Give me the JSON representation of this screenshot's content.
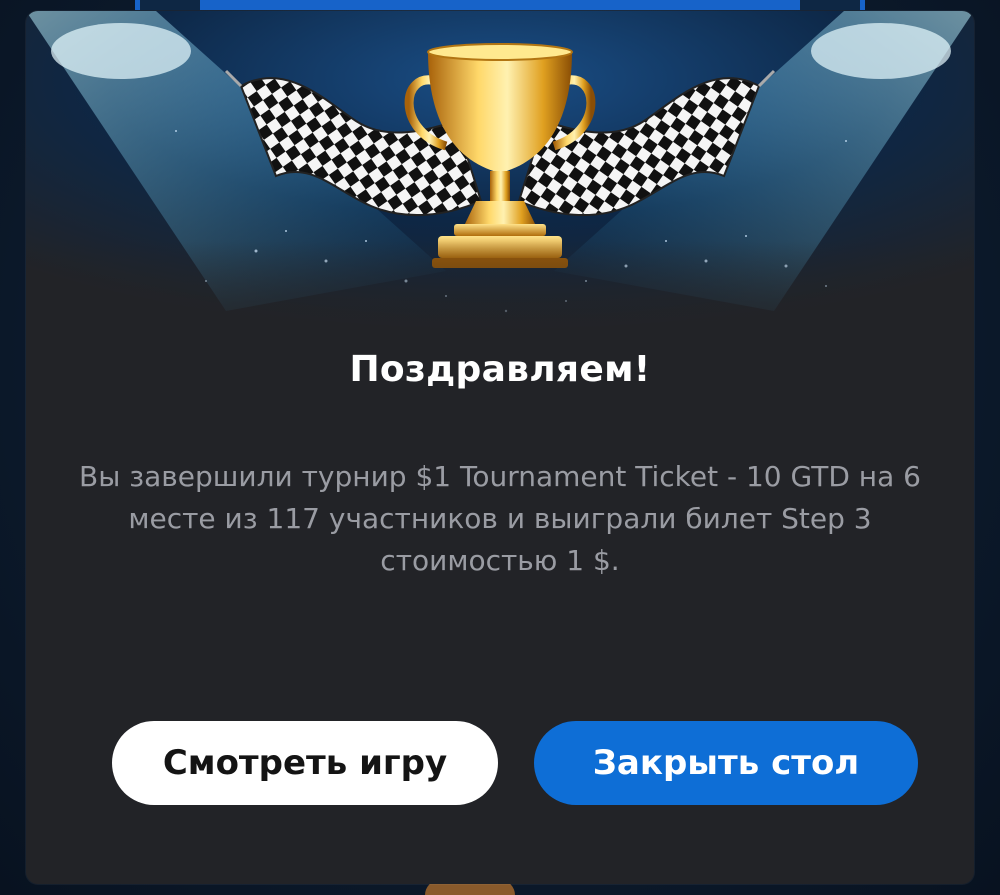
{
  "dialog": {
    "title": "Поздравляем!",
    "message": "Вы завершили турнир $1 Tournament Ticket - 10 GTD на 6 месте из 117 участников и выиграли билет Step 3 стоимостью 1 $.",
    "icon": "trophy-with-checkered-flags"
  },
  "buttons": {
    "watch_label": "Смотреть игру",
    "close_label": "Закрыть стол"
  },
  "colors": {
    "dialog_bg": "#222327",
    "primary": "#0e6ed6",
    "secondary_bg": "#ffffff",
    "title_text": "#ffffff",
    "message_text": "#9a9ca3"
  }
}
